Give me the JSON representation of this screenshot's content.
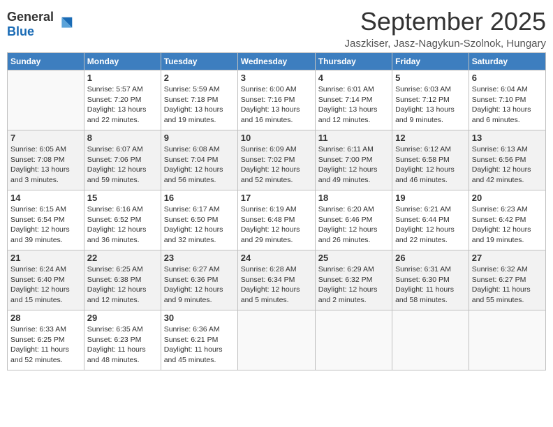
{
  "header": {
    "logo_general": "General",
    "logo_blue": "Blue",
    "month_title": "September 2025",
    "subtitle": "Jaszkiser, Jasz-Nagykun-Szolnok, Hungary"
  },
  "days_of_week": [
    "Sunday",
    "Monday",
    "Tuesday",
    "Wednesday",
    "Thursday",
    "Friday",
    "Saturday"
  ],
  "weeks": [
    [
      {
        "day": "",
        "info": ""
      },
      {
        "day": "1",
        "info": "Sunrise: 5:57 AM\nSunset: 7:20 PM\nDaylight: 13 hours\nand 22 minutes."
      },
      {
        "day": "2",
        "info": "Sunrise: 5:59 AM\nSunset: 7:18 PM\nDaylight: 13 hours\nand 19 minutes."
      },
      {
        "day": "3",
        "info": "Sunrise: 6:00 AM\nSunset: 7:16 PM\nDaylight: 13 hours\nand 16 minutes."
      },
      {
        "day": "4",
        "info": "Sunrise: 6:01 AM\nSunset: 7:14 PM\nDaylight: 13 hours\nand 12 minutes."
      },
      {
        "day": "5",
        "info": "Sunrise: 6:03 AM\nSunset: 7:12 PM\nDaylight: 13 hours\nand 9 minutes."
      },
      {
        "day": "6",
        "info": "Sunrise: 6:04 AM\nSunset: 7:10 PM\nDaylight: 13 hours\nand 6 minutes."
      }
    ],
    [
      {
        "day": "7",
        "info": "Sunrise: 6:05 AM\nSunset: 7:08 PM\nDaylight: 13 hours\nand 3 minutes."
      },
      {
        "day": "8",
        "info": "Sunrise: 6:07 AM\nSunset: 7:06 PM\nDaylight: 12 hours\nand 59 minutes."
      },
      {
        "day": "9",
        "info": "Sunrise: 6:08 AM\nSunset: 7:04 PM\nDaylight: 12 hours\nand 56 minutes."
      },
      {
        "day": "10",
        "info": "Sunrise: 6:09 AM\nSunset: 7:02 PM\nDaylight: 12 hours\nand 52 minutes."
      },
      {
        "day": "11",
        "info": "Sunrise: 6:11 AM\nSunset: 7:00 PM\nDaylight: 12 hours\nand 49 minutes."
      },
      {
        "day": "12",
        "info": "Sunrise: 6:12 AM\nSunset: 6:58 PM\nDaylight: 12 hours\nand 46 minutes."
      },
      {
        "day": "13",
        "info": "Sunrise: 6:13 AM\nSunset: 6:56 PM\nDaylight: 12 hours\nand 42 minutes."
      }
    ],
    [
      {
        "day": "14",
        "info": "Sunrise: 6:15 AM\nSunset: 6:54 PM\nDaylight: 12 hours\nand 39 minutes."
      },
      {
        "day": "15",
        "info": "Sunrise: 6:16 AM\nSunset: 6:52 PM\nDaylight: 12 hours\nand 36 minutes."
      },
      {
        "day": "16",
        "info": "Sunrise: 6:17 AM\nSunset: 6:50 PM\nDaylight: 12 hours\nand 32 minutes."
      },
      {
        "day": "17",
        "info": "Sunrise: 6:19 AM\nSunset: 6:48 PM\nDaylight: 12 hours\nand 29 minutes."
      },
      {
        "day": "18",
        "info": "Sunrise: 6:20 AM\nSunset: 6:46 PM\nDaylight: 12 hours\nand 26 minutes."
      },
      {
        "day": "19",
        "info": "Sunrise: 6:21 AM\nSunset: 6:44 PM\nDaylight: 12 hours\nand 22 minutes."
      },
      {
        "day": "20",
        "info": "Sunrise: 6:23 AM\nSunset: 6:42 PM\nDaylight: 12 hours\nand 19 minutes."
      }
    ],
    [
      {
        "day": "21",
        "info": "Sunrise: 6:24 AM\nSunset: 6:40 PM\nDaylight: 12 hours\nand 15 minutes."
      },
      {
        "day": "22",
        "info": "Sunrise: 6:25 AM\nSunset: 6:38 PM\nDaylight: 12 hours\nand 12 minutes."
      },
      {
        "day": "23",
        "info": "Sunrise: 6:27 AM\nSunset: 6:36 PM\nDaylight: 12 hours\nand 9 minutes."
      },
      {
        "day": "24",
        "info": "Sunrise: 6:28 AM\nSunset: 6:34 PM\nDaylight: 12 hours\nand 5 minutes."
      },
      {
        "day": "25",
        "info": "Sunrise: 6:29 AM\nSunset: 6:32 PM\nDaylight: 12 hours\nand 2 minutes."
      },
      {
        "day": "26",
        "info": "Sunrise: 6:31 AM\nSunset: 6:30 PM\nDaylight: 11 hours\nand 58 minutes."
      },
      {
        "day": "27",
        "info": "Sunrise: 6:32 AM\nSunset: 6:27 PM\nDaylight: 11 hours\nand 55 minutes."
      }
    ],
    [
      {
        "day": "28",
        "info": "Sunrise: 6:33 AM\nSunset: 6:25 PM\nDaylight: 11 hours\nand 52 minutes."
      },
      {
        "day": "29",
        "info": "Sunrise: 6:35 AM\nSunset: 6:23 PM\nDaylight: 11 hours\nand 48 minutes."
      },
      {
        "day": "30",
        "info": "Sunrise: 6:36 AM\nSunset: 6:21 PM\nDaylight: 11 hours\nand 45 minutes."
      },
      {
        "day": "",
        "info": ""
      },
      {
        "day": "",
        "info": ""
      },
      {
        "day": "",
        "info": ""
      },
      {
        "day": "",
        "info": ""
      }
    ]
  ]
}
